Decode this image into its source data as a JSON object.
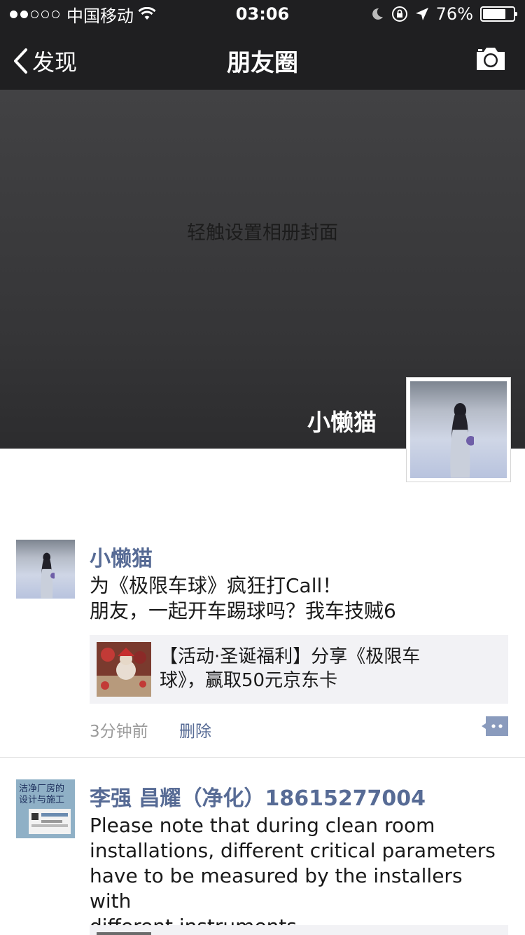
{
  "status_bar": {
    "carrier": "中国移动",
    "time": "03:06",
    "battery": "76%",
    "battery_level": 0.76
  },
  "nav": {
    "back_label": "发现",
    "title": "朋友圈"
  },
  "cover": {
    "hint": "轻触设置相册封面",
    "user_name": "小懒猫"
  },
  "posts": [
    {
      "name": "小懒猫",
      "text_lines": [
        "为《极限车球》疯狂打Call！",
        "朋友，一起开车踢球吗？我车技贼6"
      ],
      "link": {
        "lines": [
          "【活动·圣诞福利】分享《极限车",
          "球》，赢取50元京东卡"
        ]
      },
      "time": "3分钟前",
      "delete_label": "删除"
    },
    {
      "name": "李强 昌耀（净化）18615277004",
      "avatar_text": [
        "洁净厂房的",
        "设计与施工"
      ],
      "text_lines": [
        "Please note that during clean room",
        "installations, different critical parameters",
        "have to be measured by the installers with",
        "different instruments."
      ]
    }
  ],
  "colors": {
    "bar_bg": "#1f1f21",
    "link_blue": "#576b95",
    "card_bg": "#f2f2f5"
  }
}
